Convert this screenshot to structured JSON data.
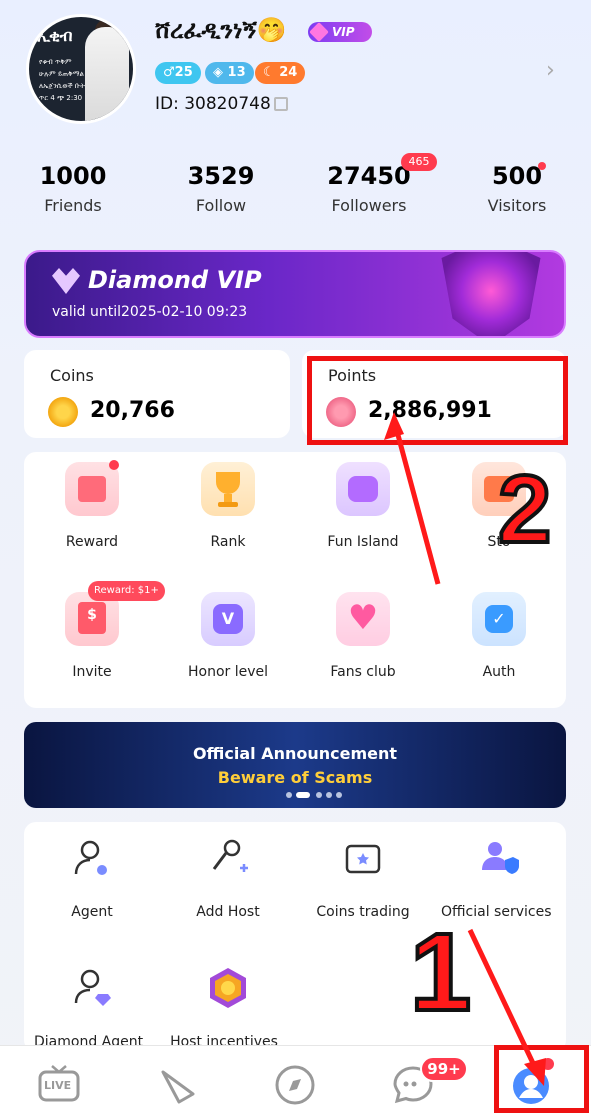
{
  "profile": {
    "username": "ሸረፈዲንነኝ🤭",
    "vip_badge": "VIP",
    "badges": [
      {
        "icon": "male-icon",
        "value": "25",
        "color": "#3fc6f0"
      },
      {
        "icon": "shield-icon",
        "value": "13",
        "color": "#4fb8ec"
      },
      {
        "icon": "moon-icon",
        "value": "24",
        "color": "#ff7a2e"
      }
    ],
    "id_label": "ID: 30820748"
  },
  "stats": [
    {
      "value": "1000",
      "label": "Friends"
    },
    {
      "value": "3529",
      "label": "Follow"
    },
    {
      "value": "27450",
      "label": "Followers",
      "badge": "465"
    },
    {
      "value": "500",
      "label": "Visitors"
    }
  ],
  "vip_banner": {
    "title": "Diamond VIP",
    "subtitle": "valid until2025-02-10 09:23"
  },
  "wallet": {
    "coins_label": "Coins",
    "coins_value": "20,766",
    "points_label": "Points",
    "points_value": "2,886,991"
  },
  "features": [
    {
      "label": "Reward",
      "icon": "gift-icon",
      "color": "#ff6b7a"
    },
    {
      "label": "Rank",
      "icon": "trophy-icon",
      "color": "#ffb02e"
    },
    {
      "label": "Fun Island",
      "icon": "gamepad-icon",
      "color": "#b36bff"
    },
    {
      "label": "Sto",
      "icon": "store-icon",
      "color": "#ff7a4a"
    },
    {
      "label": "Invite",
      "icon": "envelope-icon",
      "color": "#ff5a6a",
      "tag": "Reward: $1+"
    },
    {
      "label": "Honor level",
      "icon": "honor-v-icon",
      "color": "#8a6bff"
    },
    {
      "label": "Fans club",
      "icon": "heart-icon",
      "color": "#ff5aa0"
    },
    {
      "label": "Auth",
      "icon": "verified-icon",
      "color": "#3a9bff"
    }
  ],
  "announcement": {
    "title": "Official Announcement",
    "subtitle": "Beware of Scams"
  },
  "services": [
    {
      "label": "Agent",
      "icon": "agent-icon"
    },
    {
      "label": "Add Host",
      "icon": "microphone-icon"
    },
    {
      "label": "Coins trading",
      "icon": "wallet-icon"
    },
    {
      "label": "Official services",
      "icon": "support-icon"
    },
    {
      "label": "Diamond Agent",
      "icon": "diamond-agent-icon"
    },
    {
      "label": "Host incentives",
      "icon": "host-badge-icon"
    }
  ],
  "nav": {
    "live": "LIVE",
    "messages_badge": "99+"
  },
  "annotations": {
    "step1": "1",
    "step2": "2"
  }
}
